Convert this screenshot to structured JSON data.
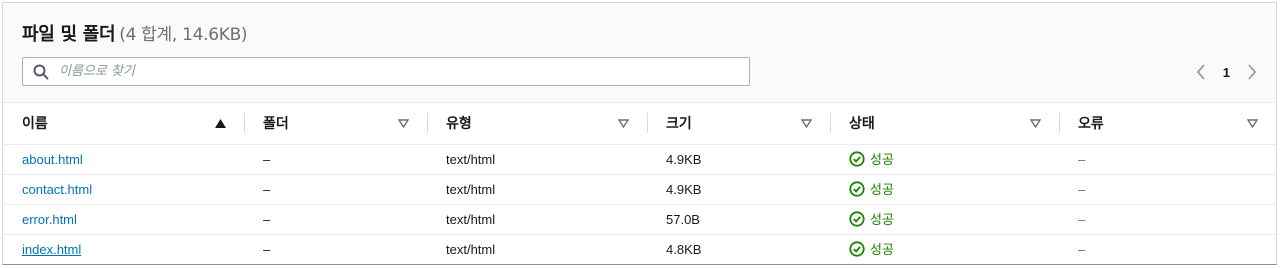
{
  "header": {
    "title": "파일 및 폴더",
    "count": "(4 합계, 14.6KB)"
  },
  "search": {
    "placeholder": "이름으로 찾기",
    "value": ""
  },
  "pagination": {
    "current_page": "1"
  },
  "table": {
    "columns": [
      {
        "label": "이름",
        "sort": "ascending"
      },
      {
        "label": "폴더",
        "sort": "none"
      },
      {
        "label": "유형",
        "sort": "none"
      },
      {
        "label": "크기",
        "sort": "none"
      },
      {
        "label": "상태",
        "sort": "none"
      },
      {
        "label": "오류",
        "sort": "none"
      }
    ],
    "rows": [
      {
        "name": "about.html",
        "folder": "–",
        "type": "text/html",
        "size": "4.9KB",
        "status": "성공",
        "error": "–"
      },
      {
        "name": "contact.html",
        "folder": "–",
        "type": "text/html",
        "size": "4.9KB",
        "status": "성공",
        "error": "–"
      },
      {
        "name": "error.html",
        "folder": "–",
        "type": "text/html",
        "size": "57.0B",
        "status": "성공",
        "error": "–"
      },
      {
        "name": "index.html",
        "folder": "–",
        "type": "text/html",
        "size": "4.8KB",
        "status": "성공",
        "error": "–"
      }
    ]
  },
  "colors": {
    "link": "#0073bb",
    "success": "#1d8102",
    "header_bg": "#fafafa",
    "muted": "#687078"
  }
}
